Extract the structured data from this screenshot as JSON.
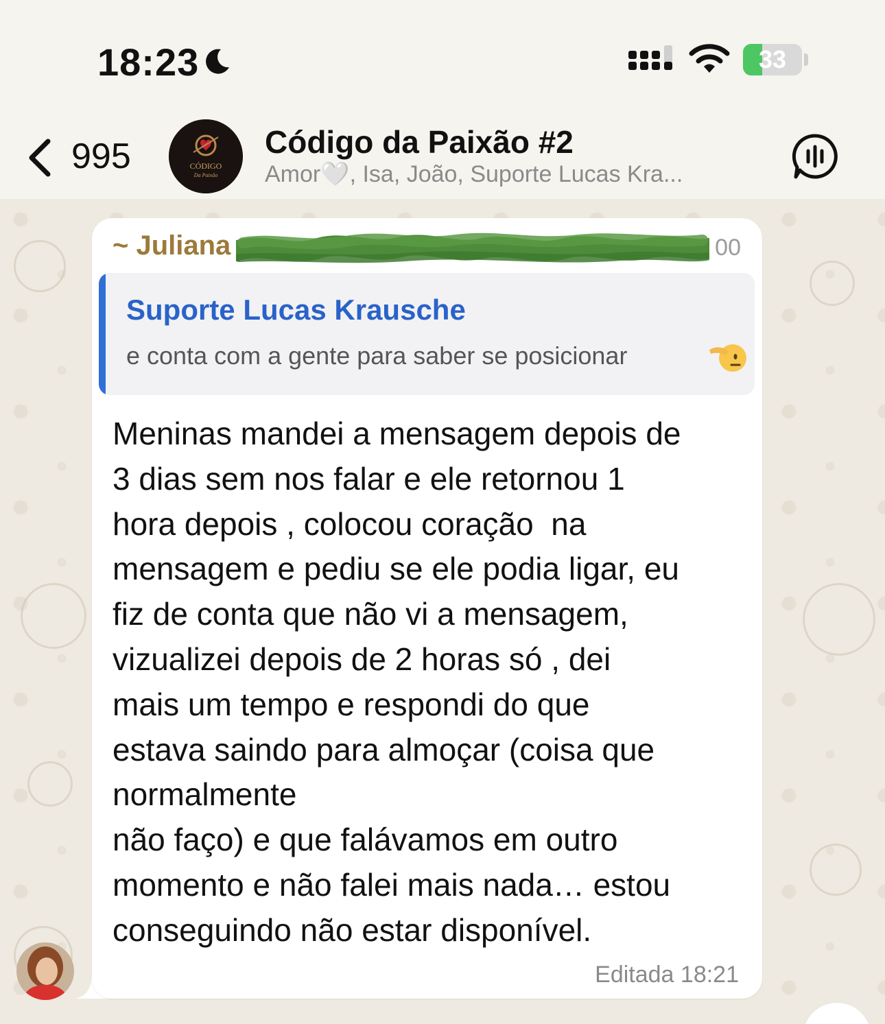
{
  "status_bar": {
    "time": "18:23",
    "battery_level": "33",
    "battery_fill_fraction": 0.33,
    "focus_icon": "moon-icon",
    "signal_icon": "cellular-signal-icon",
    "wifi_icon": "wifi-icon",
    "battery_color": "#4cc764"
  },
  "header": {
    "back_count": "995",
    "group_name": "Código da Paixão #2",
    "members": "Amor🤍, Isa, João, Suporte Lucas Kra...",
    "avatar_label": "CÓDIGO",
    "avatar_sublabel": "Da Paixão",
    "voice_chat_icon": "voice-chat-icon"
  },
  "message": {
    "sender_name": "~ Juliana",
    "sender_phone_fragment": "00",
    "sender_color": "#9c7a3c",
    "quote": {
      "author": "Suporte Lucas Krausche",
      "text": "e conta com a gente para saber se posicionar",
      "emoji": "🫡",
      "accent_color": "#2f6fd6"
    },
    "body_lines": [
      "Meninas mandei a mensagem depois de",
      "3 dias sem nos falar e ele retornou 1",
      "hora depois , colocou coração  na",
      "mensagem e pediu se ele podia ligar, eu",
      "fiz de conta que não vi a mensagem,",
      "vizualizei depois de 2 horas só , dei",
      "mais um tempo e respondi do que",
      "estava saindo para almoçar (coisa que",
      "normalmente",
      "não faço) e que falávamos em outro",
      "momento e não falei mais nada… estou",
      "conseguindo não estar disponível."
    ],
    "meta": "Editada 18:21"
  }
}
